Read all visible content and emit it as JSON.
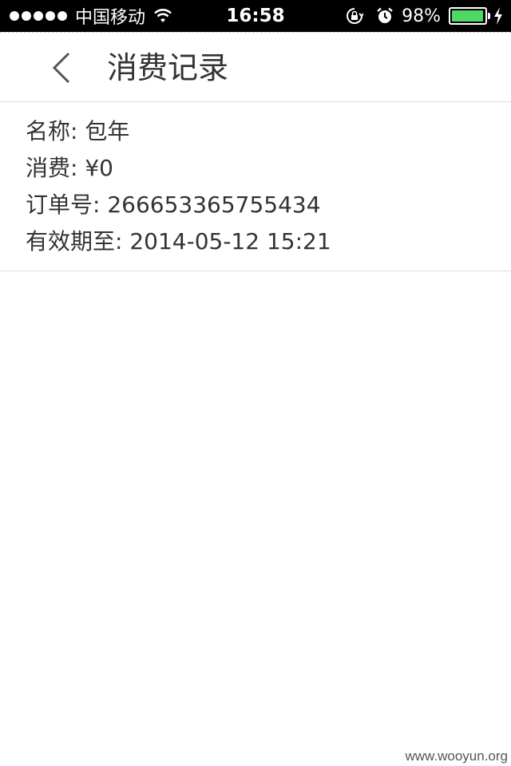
{
  "status_bar": {
    "carrier": "中国移动",
    "time": "16:58",
    "battery_percent": "98%",
    "battery_level": 0.98,
    "icons": [
      "signal-dots-icon",
      "wifi-icon",
      "rotation-lock-icon",
      "alarm-icon",
      "battery-icon",
      "charging-bolt-icon"
    ]
  },
  "nav": {
    "title": "消费记录",
    "back_icon": "chevron-left-icon"
  },
  "record": {
    "name": "名称: 包年",
    "cost": "消费: ¥0",
    "order": "订单号: 266653365755434",
    "expiry": "有效期至: 2014-05-12 15:21"
  },
  "watermark": "www.wooyun.org",
  "colors": {
    "status_bar_bg": "#000000",
    "battery_fill": "#4cd964",
    "text": "#333333",
    "divider": "#dddddd"
  }
}
